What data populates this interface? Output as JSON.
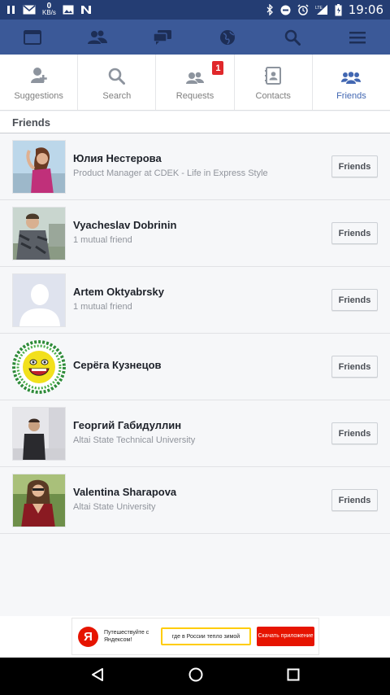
{
  "status_bar": {
    "speed_value": "0",
    "speed_unit": "KB/s",
    "network_type": "LTE",
    "time": "19:06"
  },
  "top_nav": {
    "icons": [
      "feed-icon",
      "friends-icon",
      "messages-icon",
      "notifications-globe-icon",
      "search-icon",
      "menu-icon"
    ],
    "active_color": "#ffffff",
    "background_color": "#3b5998"
  },
  "tabs": [
    {
      "label": "Suggestions",
      "icon": "add-person-icon",
      "active": false
    },
    {
      "label": "Search",
      "icon": "search-icon",
      "active": false
    },
    {
      "label": "Requests",
      "icon": "requests-icon",
      "active": false,
      "badge": "1"
    },
    {
      "label": "Contacts",
      "icon": "contacts-icon",
      "active": false
    },
    {
      "label": "Friends",
      "icon": "friends-icon",
      "active": true
    }
  ],
  "section_title": "Friends",
  "friends": [
    {
      "name": "Юлия Нестерова",
      "subtitle": "Product Manager at CDEK - Life in Express Style",
      "button": "Friends"
    },
    {
      "name": "Vyacheslav Dobrinin",
      "subtitle": "1 mutual friend",
      "button": "Friends"
    },
    {
      "name": "Artem Oktyabrsky",
      "subtitle": "1 mutual friend",
      "button": "Friends"
    },
    {
      "name": "Серёга Кузнецов",
      "subtitle": "",
      "button": "Friends"
    },
    {
      "name": "Георгий Габидуллин",
      "subtitle": "Altai State Technical University",
      "button": "Friends"
    },
    {
      "name": "Valentina Sharapova",
      "subtitle": "Altai State University",
      "button": "Friends"
    }
  ],
  "ad": {
    "logo_letter": "Я",
    "text": "Путешествуйте с Яндексом!",
    "search_text": "где в России тепло зимой",
    "cta": "Скачать приложение"
  },
  "colors": {
    "brand": "#3b5998",
    "active_tab": "#4267b2",
    "badge": "#e0282b",
    "ad_red": "#e61400"
  }
}
